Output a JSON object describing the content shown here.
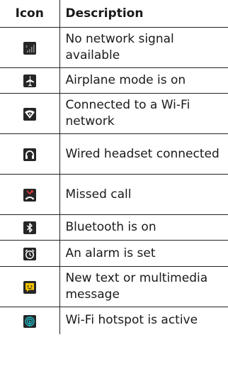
{
  "table": {
    "header_icon": "Icon",
    "header_description": "Description",
    "rows": [
      {
        "icon": "no-signal-icon",
        "description": "No network signal available"
      },
      {
        "icon": "airplane-icon",
        "description": "Airplane mode is on"
      },
      {
        "icon": "wifi-icon",
        "description": "Connected to a Wi-Fi network"
      },
      {
        "icon": "headset-icon",
        "description": "Wired headset connected"
      },
      {
        "icon": "missed-call-icon",
        "description": "Missed call"
      },
      {
        "icon": "bluetooth-icon",
        "description": "Bluetooth is on"
      },
      {
        "icon": "alarm-icon",
        "description": "An alarm is set"
      },
      {
        "icon": "message-icon",
        "description": "New text or multimedia message"
      },
      {
        "icon": "hotspot-icon",
        "description": "Wi-Fi hotspot is active"
      }
    ]
  },
  "colors": {
    "tile": "#262626",
    "glyph": "#ffffff",
    "missed_call_accent": "#e53935",
    "message_accent": "#f2c300",
    "hotspot_accent": "#1fb8c7",
    "signal_dim": "#8a8a8a"
  }
}
